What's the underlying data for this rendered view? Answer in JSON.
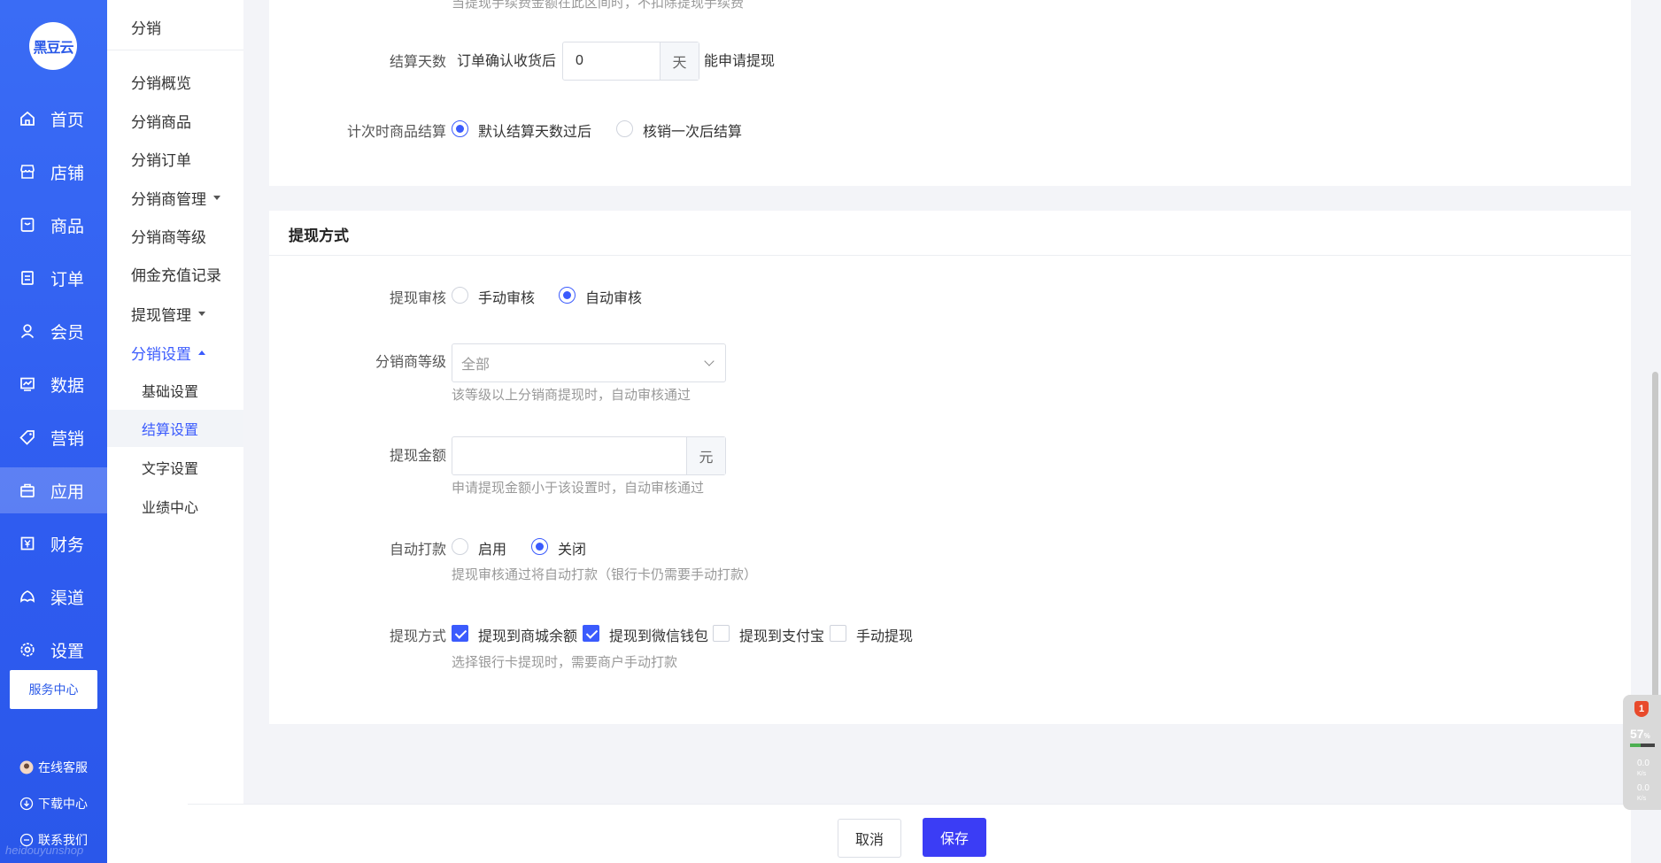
{
  "brand": {
    "logo_text": "黑豆云",
    "watermark": "heidouyunshop"
  },
  "sidebar": {
    "items": [
      {
        "label": "首页",
        "icon": "home-icon"
      },
      {
        "label": "店铺",
        "icon": "store-icon"
      },
      {
        "label": "商品",
        "icon": "goods-icon"
      },
      {
        "label": "订单",
        "icon": "order-icon"
      },
      {
        "label": "会员",
        "icon": "member-icon"
      },
      {
        "label": "数据",
        "icon": "data-icon"
      },
      {
        "label": "营销",
        "icon": "tag-icon"
      },
      {
        "label": "应用",
        "icon": "app-icon"
      },
      {
        "label": "财务",
        "icon": "finance-icon"
      },
      {
        "label": "渠道",
        "icon": "channel-icon"
      },
      {
        "label": "设置",
        "icon": "gear-icon"
      }
    ],
    "active": "应用",
    "service_center": "服务中心",
    "links": [
      {
        "label": "在线客服",
        "icon": "support-avatar-icon"
      },
      {
        "label": "下载中心",
        "icon": "download-icon"
      },
      {
        "label": "联系我们",
        "icon": "contact-icon"
      }
    ]
  },
  "submenu": {
    "title": "分销",
    "items": [
      "分销概览",
      "分销商品",
      "分销订单",
      "分销商管理",
      "分销商等级",
      "佣金充值记录",
      "提现管理",
      "分销设置"
    ],
    "sub_items": [
      "基础设置",
      "结算设置",
      "文字设置",
      "业绩中心"
    ],
    "active_sub": "结算设置"
  },
  "settlement": {
    "top_hint": "当提现手续费金额在此区间时，不扣除提现手续费",
    "days_label": "结算天数",
    "days_prefix": "订单确认收货后",
    "days_value": "0",
    "days_unit": "天",
    "days_suffix": "能申请提现",
    "timed_label": "计次时商品结算",
    "timed_options": [
      "默认结算天数过后",
      "核销一次后结算"
    ],
    "timed_selected": 0
  },
  "withdraw": {
    "section_title": "提现方式",
    "review_label": "提现审核",
    "review_options": [
      "手动审核",
      "自动审核"
    ],
    "review_selected": 1,
    "level_label": "分销商等级",
    "level_value": "全部",
    "level_hint": "该等级以上分销商提现时，自动审核通过",
    "amount_label": "提现金额",
    "amount_value": "",
    "amount_unit": "元",
    "amount_hint": "申请提现金额小于该设置时，自动审核通过",
    "autopay_label": "自动打款",
    "autopay_options": [
      "启用",
      "关闭"
    ],
    "autopay_selected": 1,
    "autopay_hint": "提现审核通过将自动打款（银行卡仍需要手动打款）",
    "method_label": "提现方式",
    "methods": [
      {
        "label": "提现到商城余额",
        "checked": true
      },
      {
        "label": "提现到微信钱包",
        "checked": true
      },
      {
        "label": "提现到支付宝",
        "checked": false
      },
      {
        "label": "手动提现",
        "checked": false
      }
    ],
    "method_hint": "选择银行卡提现时，需要商户手动打款"
  },
  "footer": {
    "cancel": "取消",
    "save": "保存"
  },
  "widget": {
    "badge": "1",
    "percent": "57",
    "percent_unit": "%",
    "up": "0.0",
    "down": "0.0",
    "unit": "K/s"
  },
  "colors": {
    "primary": "#3b5bfd",
    "sidebar": "#2f5cf0",
    "save_button": "#3b3df5"
  }
}
